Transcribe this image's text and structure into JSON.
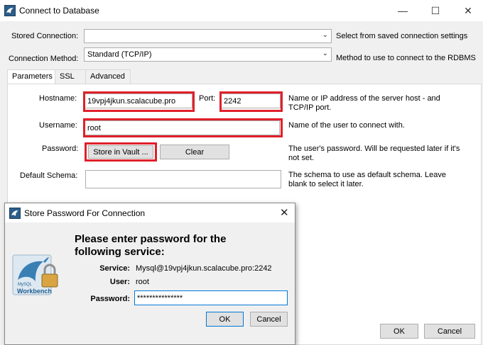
{
  "window": {
    "title": "Connect to Database",
    "minimize_icon": "minimize-icon",
    "maximize_icon": "maximize-icon",
    "close_icon": "close-icon"
  },
  "stored_connection": {
    "label": "Stored Connection:",
    "value": "",
    "description": "Select from saved connection settings"
  },
  "connection_method": {
    "label": "Connection Method:",
    "value": "Standard (TCP/IP)",
    "description": "Method to use to connect to the RDBMS"
  },
  "tabs": [
    {
      "label": "Parameters",
      "active": true
    },
    {
      "label": "SSL",
      "active": false
    },
    {
      "label": "Advanced",
      "active": false
    }
  ],
  "params": {
    "hostname_label": "Hostname:",
    "hostname_value": "19vpj4jkun.scalacube.pro",
    "port_label": "Port:",
    "port_value": "2242",
    "host_description_1": "Name or IP address of the server host - and",
    "host_description_2": "TCP/IP port.",
    "username_label": "Username:",
    "username_value": "root",
    "username_description": "Name of the user to connect with.",
    "password_label": "Password:",
    "store_vault_button": "Store in Vault ...",
    "clear_button": "Clear",
    "password_description_1": "The user's password. Will be requested later if it's",
    "password_description_2": "not set.",
    "schema_label": "Default Schema:",
    "schema_value": "",
    "schema_description_1": "The schema to use as default schema. Leave",
    "schema_description_2": "blank to select it later."
  },
  "dialog": {
    "title": "Store Password For Connection",
    "heading_1": "Please enter password for the",
    "heading_2": "following service:",
    "service_label": "Service:",
    "service_value": "Mysql@19vpj4jkun.scalacube.pro:2242",
    "user_label": "User:",
    "user_value": "root",
    "password_label": "Password:",
    "password_value": "***************",
    "ok_button": "OK",
    "cancel_button": "Cancel",
    "logo_text_1": "MySQL",
    "logo_text_2": "Workbench"
  },
  "footer": {
    "ok_button": "OK",
    "cancel_button": "Cancel"
  },
  "colors": {
    "highlight": "#e0202a",
    "focus_border": "#0078d7"
  }
}
